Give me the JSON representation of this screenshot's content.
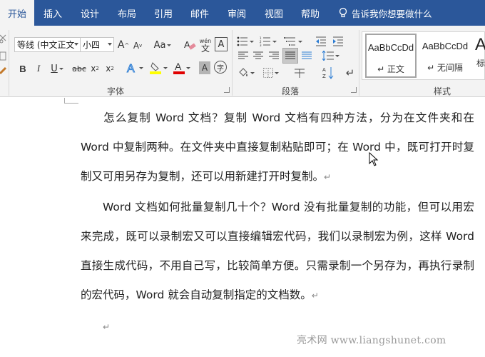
{
  "tabs": [
    {
      "label": "开始",
      "active": true
    },
    {
      "label": "插入",
      "active": false
    },
    {
      "label": "设计",
      "active": false
    },
    {
      "label": "布局",
      "active": false
    },
    {
      "label": "引用",
      "active": false
    },
    {
      "label": "邮件",
      "active": false
    },
    {
      "label": "审阅",
      "active": false
    },
    {
      "label": "视图",
      "active": false
    },
    {
      "label": "帮助",
      "active": false
    }
  ],
  "tell_me": "告诉我你想要做什么",
  "font_group": {
    "font_name": "等线 (中文正文",
    "font_size": "小四",
    "label": "字体",
    "aa_label": "Aa",
    "phonetic_top": "wén",
    "phonetic_bottom": "文"
  },
  "paragraph_group": {
    "label": "段落"
  },
  "styles_group": {
    "label": "样式",
    "items": [
      {
        "sample": "AaBbCcDd",
        "name": "↵ 正文"
      },
      {
        "sample": "AaBbCcDd",
        "name": "↵ 无间隔"
      },
      {
        "sample": "A",
        "name": "标"
      }
    ]
  },
  "document": {
    "paragraphs": [
      "怎么复制 Word 文档？复制 Word 文档有四种方法，分为在文件夹和在 Word 中复制两种。在文件夹中直接复制粘贴即可；在 Word 中，既可打开时复制又可用另存为复制，还可以用新建打开时复制。",
      "Word 文档如何批量复制几十个？Word 没有批量复制的功能，但可以用宏来完成，既可以录制宏又可以直接编辑宏代码，我们以录制宏为例，这样 Word 直接生成代码，不用自己写，比较简单方便。只需录制一个另存为，再执行录制的宏代码，Word 就会自动复制指定的文档数。"
    ],
    "paragraph_mark": "↵"
  },
  "watermark": "亮术网 www.liangshunet.com",
  "colors": {
    "tab_bar": "#2b579a",
    "ribbon": "#f3f3f3",
    "highlight": "#ffff00",
    "font_color": "#e00000"
  }
}
